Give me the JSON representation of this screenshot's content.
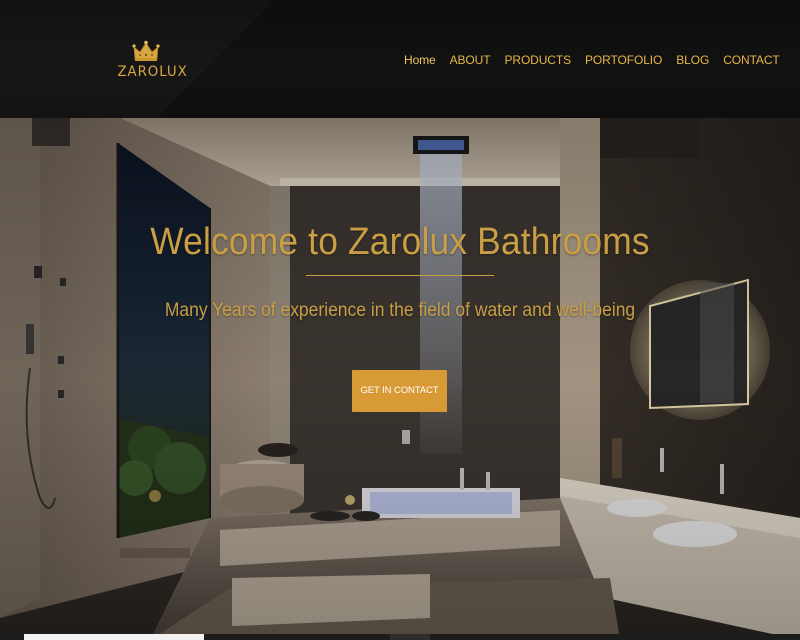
{
  "brand": {
    "name": "ZAROLUX",
    "logo_icon": "crown-icon",
    "accent_color": "#d6a742"
  },
  "nav": {
    "items": [
      {
        "label": "Home",
        "active": true
      },
      {
        "label": "ABOUT"
      },
      {
        "label": "PRODUCTS"
      },
      {
        "label": "PORTOFOLIO"
      },
      {
        "label": "BLOG"
      },
      {
        "label": "CONTACT"
      }
    ]
  },
  "hero": {
    "title": "Welcome to Zarolux Bathrooms",
    "subtitle": "Many Years of experience in the field of water and well-being",
    "cta_label": "GET IN CONTACT",
    "cta_color": "#d89a35",
    "text_color": "#c99e45"
  }
}
